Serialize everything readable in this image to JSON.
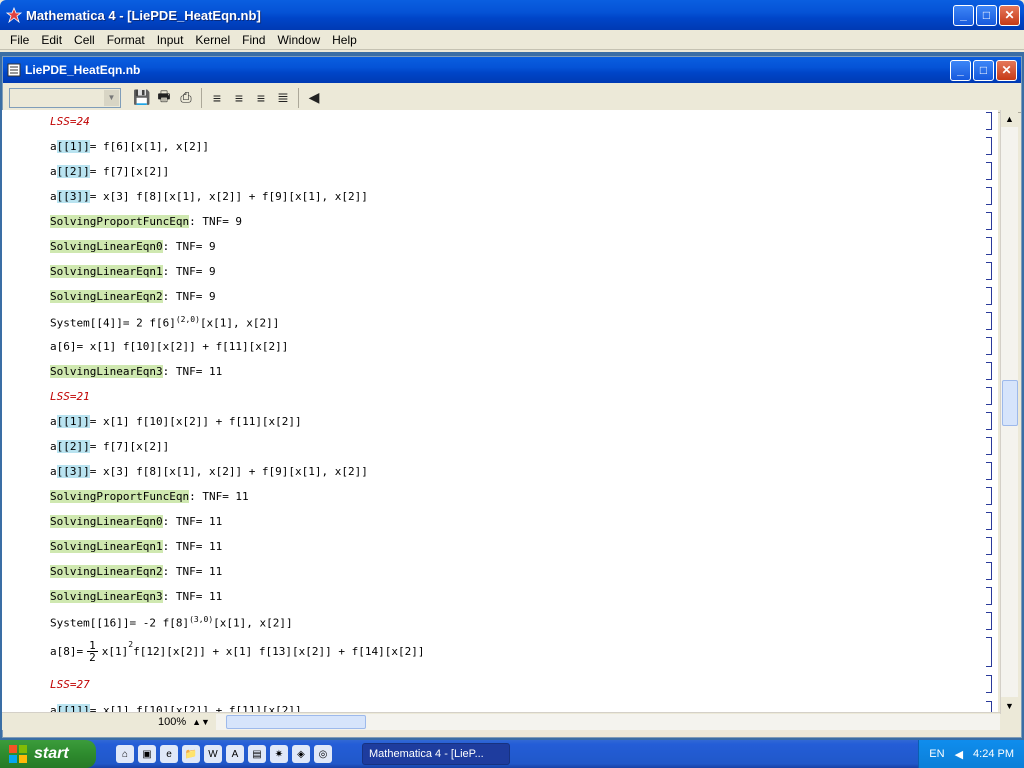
{
  "app": {
    "title": "Mathematica 4 - [LiePDE_HeatEqn.nb]",
    "menu": [
      "File",
      "Edit",
      "Cell",
      "Format",
      "Input",
      "Kernel",
      "Find",
      "Window",
      "Help"
    ]
  },
  "document": {
    "title": "LiePDE_HeatEqn.nb",
    "zoom": "100%"
  },
  "cells": [
    {
      "type": "lss",
      "text": "LSS=24"
    },
    {
      "type": "code",
      "pre": "a",
      "hl": "[[1]]",
      "post": "= f[6][x[1], x[2]]"
    },
    {
      "type": "code",
      "pre": "a",
      "hl": "[[2]]",
      "post": "= f[7][x[2]]"
    },
    {
      "type": "code",
      "pre": "a",
      "hl": "[[3]]",
      "post": "= x[3] f[8][x[1], x[2]] + f[9][x[1], x[2]]"
    },
    {
      "type": "green",
      "hl": "SolvingProportFuncEqn",
      "post": ": TNF= 9"
    },
    {
      "type": "green",
      "hl": "SolvingLinearEqn0",
      "post": ": TNF= 9"
    },
    {
      "type": "green",
      "hl": "SolvingLinearEqn1",
      "post": ": TNF= 9"
    },
    {
      "type": "green",
      "hl": "SolvingLinearEqn2",
      "post": ": TNF= 9"
    },
    {
      "type": "plain",
      "text": "System[[4]]= 2 f[6]",
      "sup": "(2,0)",
      "post": "[x[1], x[2]]"
    },
    {
      "type": "plain",
      "text": "a[6]= x[1] f[10][x[2]] + f[11][x[2]]"
    },
    {
      "type": "green",
      "hl": "SolvingLinearEqn3",
      "post": ": TNF= 11"
    },
    {
      "type": "lss",
      "text": "LSS=21"
    },
    {
      "type": "code",
      "pre": "a",
      "hl": "[[1]]",
      "post": "= x[1] f[10][x[2]] + f[11][x[2]]"
    },
    {
      "type": "code",
      "pre": "a",
      "hl": "[[2]]",
      "post": "= f[7][x[2]]"
    },
    {
      "type": "code",
      "pre": "a",
      "hl": "[[3]]",
      "post": "= x[3] f[8][x[1], x[2]] + f[9][x[1], x[2]]"
    },
    {
      "type": "green",
      "hl": "SolvingProportFuncEqn",
      "post": ": TNF= 11"
    },
    {
      "type": "green",
      "hl": "SolvingLinearEqn0",
      "post": ": TNF= 11"
    },
    {
      "type": "green",
      "hl": "SolvingLinearEqn1",
      "post": ": TNF= 11"
    },
    {
      "type": "green",
      "hl": "SolvingLinearEqn2",
      "post": ": TNF= 11"
    },
    {
      "type": "green",
      "hl": "SolvingLinearEqn3",
      "post": ": TNF= 11"
    },
    {
      "type": "plain",
      "text": "System[[16]]= -2 f[8]",
      "sup": "(3,0)",
      "post": "[x[1], x[2]]"
    },
    {
      "type": "frac",
      "pre": "a[8]=",
      "num": "1",
      "den": "2",
      "mid": "x[1]",
      "sup": "2",
      "post": "f[12][x[2]] + x[1] f[13][x[2]] + f[14][x[2]]"
    },
    {
      "type": "lss",
      "text": "LSS=27"
    },
    {
      "type": "code",
      "pre": "a",
      "hl": "[[1]]",
      "post": "= x[1] f[10][x[2]] + f[11][x[2]]"
    }
  ],
  "taskbar": {
    "start": "start",
    "task": "Mathematica 4 - [LieP...",
    "lang": "EN",
    "clock": "4:24 PM"
  }
}
